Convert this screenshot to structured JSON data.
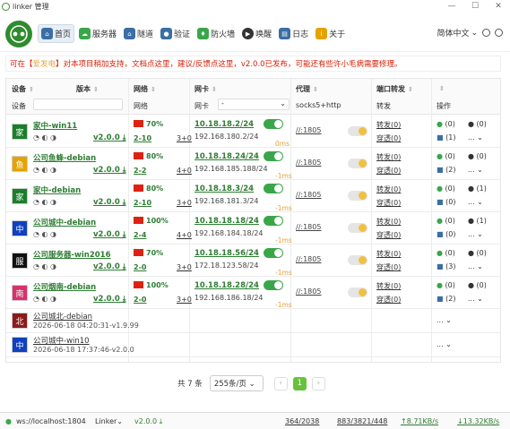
{
  "window": {
    "title": "linker 管理",
    "btn_min": "—",
    "btn_max": "☐",
    "btn_close": "✕"
  },
  "nav": {
    "items": [
      {
        "label": "首页",
        "icon": "home-icon"
      },
      {
        "label": "服务器",
        "icon": "cloud-icon"
      },
      {
        "label": "隧道",
        "icon": "tunnel-icon"
      },
      {
        "label": "验证",
        "icon": "lock-icon"
      },
      {
        "label": "防火墙",
        "icon": "shield-icon"
      },
      {
        "label": "唤醒",
        "icon": "play-icon"
      },
      {
        "label": "日志",
        "icon": "log-icon"
      },
      {
        "label": "关于",
        "icon": "info-icon"
      }
    ],
    "language": "简体中文"
  },
  "notice": {
    "p1": "可在【",
    "p2": "爱发电",
    "p3": "】对本项目稍加支持，文档点这里，建议/反馈点这里，v2.0.0已发布，可能还有些许小毛病需要修理。"
  },
  "table": {
    "headers": {
      "device": "设备",
      "version": "版本",
      "network": "网络",
      "nic": "网卡",
      "proxy": "代理",
      "forward": "端口转发",
      "ops": ""
    },
    "subheaders": {
      "device": "设备",
      "network": "网络",
      "nic": "网卡",
      "nic_select": "-",
      "proxy": "socks5+http",
      "forward": "转发",
      "ops": "操作"
    },
    "rows": [
      {
        "avatar": "家",
        "avatar_color": "#1a7f2a",
        "name": "家中-win11",
        "version": "v2.0.0 ⤓",
        "net_pct": "70%",
        "tunnel": "2-10",
        "relay": "3+0",
        "ip": "10.18.18.2/24",
        "lan": "192.168.180.2/24",
        "ms": "0ms",
        "proxy": "//:1805",
        "fwd": "转发(0)",
        "pen": "穿透(0)",
        "op1": "(0)",
        "op2": "(0)",
        "op3": "(1)"
      },
      {
        "avatar": "鱼",
        "avatar_color": "#e5a300",
        "name": "公司鱼蜂-debian",
        "version": "v2.0.0 ⤓",
        "net_pct": "80%",
        "tunnel": "2-2",
        "relay": "4+0",
        "ip": "10.18.18.24/24",
        "lan": "192.168.185.188/24",
        "ms": "-1ms",
        "proxy": "//:1805",
        "fwd": "转发(0)",
        "pen": "穿透(0)",
        "op1": "(0)",
        "op2": "(0)",
        "op3": "(2)"
      },
      {
        "avatar": "家",
        "avatar_color": "#1a7f2a",
        "name": "家中-debian",
        "version": "v2.0.0 ⤓",
        "net_pct": "80%",
        "tunnel": "2-10",
        "relay": "3+0",
        "ip": "10.18.18.3/24",
        "lan": "192.168.181.3/24",
        "ms": "-1ms",
        "proxy": "//:1805",
        "fwd": "转发(0)",
        "pen": "穿透(0)",
        "op1": "(0)",
        "op2": "(1)",
        "op3": "(0)"
      },
      {
        "avatar": "中",
        "avatar_color": "#1040c0",
        "name": "公司城中-debian",
        "version": "v2.0.0 ⤓",
        "net_pct": "100%",
        "tunnel": "2-4",
        "relay": "4+0",
        "ip": "10.18.18.18/24",
        "lan": "192.168.184.18/24",
        "ms": "-1ms",
        "proxy": "//:1805",
        "fwd": "转发(0)",
        "pen": "穿透(0)",
        "op1": "(0)",
        "op2": "(1)",
        "op3": "(0)"
      },
      {
        "avatar": "服",
        "avatar_color": "#111111",
        "name": "公司服务器-win2016",
        "version": "v2.0.0 ⤓",
        "net_pct": "70%",
        "tunnel": "2-0",
        "relay": "3+0",
        "ip": "10.18.18.56/24",
        "lan": "172.18.123.58/24",
        "ms": "-1ms",
        "proxy": "//:1805",
        "fwd": "转发(0)",
        "pen": "穿透(0)",
        "op1": "(0)",
        "op2": "(0)",
        "op3": "(3)"
      },
      {
        "avatar": "南",
        "avatar_color": "#d6336c",
        "name": "公司烟南-debian",
        "version": "v2.0.0 ⤓",
        "net_pct": "100%",
        "tunnel": "2-0",
        "relay": "3+0",
        "ip": "10.18.18.28/24",
        "lan": "192.168.186.18/24",
        "ms": "-1ms",
        "proxy": "//:1805",
        "fwd": "转发(0)",
        "pen": "穿透(0)",
        "op1": "(0)",
        "op2": "(0)",
        "op3": "(2)"
      }
    ],
    "offline": [
      {
        "avatar": "北",
        "avatar_color": "#8b1a1a",
        "name": "公司城北-debian",
        "date": "2026-06-18 04:20:31-v1.9.99",
        "more": "... ⌄"
      },
      {
        "avatar": "中",
        "avatar_color": "#1040c0",
        "name": "公司城中-win10",
        "date": "2026-06-18 17:37:46-v2.0.0",
        "more": "... ⌄"
      }
    ]
  },
  "pager": {
    "total": "共 7 条",
    "size": "255条/页",
    "current": "1",
    "prev": "‹",
    "next": "›"
  },
  "status": {
    "ws": "ws://localhost:1804",
    "app": "Linker⌄",
    "ver": "v2.0.0 ⤓",
    "s1": "364/2038",
    "s2": "883/3821/448",
    "up": "↑8.71KB/s",
    "down": "↓13.32KB/s"
  },
  "colors": {
    "accent": "#2e7d32",
    "warn": "#d81e06"
  }
}
